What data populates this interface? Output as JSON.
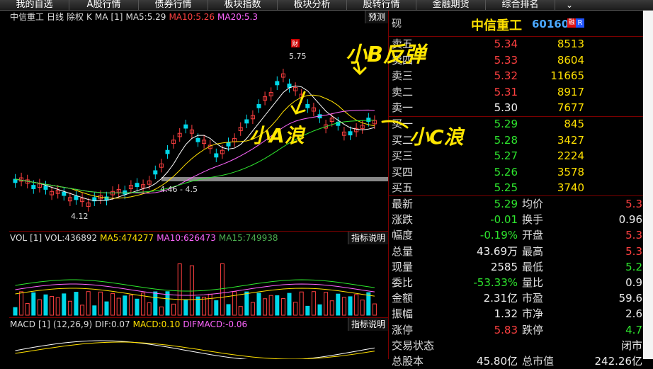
{
  "tabs": [
    "我的自选",
    "A股行情",
    "债券行情",
    "板块指数",
    "板块分析",
    "股转行情",
    "金融期货",
    "综合排名"
  ],
  "tab_more_icon": "double-chevron-down-icon",
  "kline": {
    "stock": "中信重工",
    "period": "日线",
    "adjust": "除权",
    "chart": "K",
    "indicator": "MA",
    "param": "[1]",
    "ma5": "MA5:5.29",
    "ma10": "MA10:5.26",
    "ma20": "MA20:5.3",
    "forecast_btn": "预测",
    "high_label": "5.75",
    "low_label": "4.12",
    "mid_label": "4.46 - 4.5",
    "cai_badge": "财",
    "colors": {
      "up": "#ff4040",
      "down": "#00d7e8",
      "ma5": "#ffffff",
      "ma10": "#ffe000",
      "ma20": "#ff66ff",
      "ma60": "#2ee62e"
    }
  },
  "vol": {
    "name": "VOL",
    "param": "[1]",
    "vol": "VOL:436892",
    "ma5": "MA5:474277",
    "ma10": "MA10:626473",
    "ma15": "MA15:749938",
    "help": "指标说明"
  },
  "macd": {
    "name": "MACD",
    "param": "[1]",
    "args": "(12,26,9)",
    "dif": "DIF:0.07",
    "macd": "MACD:0.10",
    "difmacd": "DIFMACD:-0.06",
    "help": "指标说明"
  },
  "quote": {
    "mark": "砚",
    "name": "中信重工",
    "code": "601608",
    "badge": "融",
    "badge2": "R",
    "asks": [
      {
        "label": "卖五",
        "price": "5.34",
        "vol": "8513"
      },
      {
        "label": "卖四",
        "price": "5.33",
        "vol": "8604"
      },
      {
        "label": "卖三",
        "price": "5.32",
        "vol": "11665"
      },
      {
        "label": "卖二",
        "price": "5.31",
        "vol": "8917"
      },
      {
        "label": "卖一",
        "price": "5.30",
        "vol": "7677"
      }
    ],
    "bids": [
      {
        "label": "买一",
        "price": "5.29",
        "vol": "845"
      },
      {
        "label": "买二",
        "price": "5.28",
        "vol": "3427"
      },
      {
        "label": "买三",
        "price": "5.27",
        "vol": "2224"
      },
      {
        "label": "买四",
        "price": "5.26",
        "vol": "3578"
      },
      {
        "label": "买五",
        "price": "5.25",
        "vol": "3740"
      }
    ],
    "stats": [
      {
        "l1": "最新",
        "v1": "5.29",
        "c1": "green",
        "l2": "均价",
        "v2": "5.3",
        "c2": "red"
      },
      {
        "l1": "涨跌",
        "v1": "-0.01",
        "c1": "green",
        "l2": "换手",
        "v2": "0.96",
        "c2": "white"
      },
      {
        "l1": "幅度",
        "v1": "-0.19%",
        "c1": "green",
        "l2": "开盘",
        "v2": "5.3",
        "c2": "red"
      },
      {
        "l1": "总量",
        "v1": "43.69万",
        "c1": "white",
        "l2": "最高",
        "v2": "5.3",
        "c2": "red"
      },
      {
        "l1": "现量",
        "v1": "2585",
        "c1": "white",
        "l2": "最低",
        "v2": "5.2",
        "c2": "green"
      },
      {
        "l1": "委比",
        "v1": "-53.33%",
        "c1": "green",
        "l2": "量比",
        "v2": "0.9",
        "c2": "white"
      },
      {
        "l1": "金额",
        "v1": "2.31亿",
        "c1": "white",
        "l2": "市盈",
        "v2": "59.6",
        "c2": "white"
      },
      {
        "l1": "振幅",
        "v1": "1.32",
        "c1": "white",
        "l2": "市净",
        "v2": "2.6",
        "c2": "white"
      },
      {
        "l1": "涨停",
        "v1": "5.83",
        "c1": "red",
        "l2": "跌停",
        "v2": "4.7",
        "c2": "green"
      },
      {
        "l1": "交易状态",
        "v1": "",
        "c1": "white",
        "l2": "",
        "v2": "闭市",
        "c2": "white"
      },
      {
        "l1": "总股本",
        "v1": "45.80亿",
        "c1": "white",
        "l2": "总市值",
        "v2": "242.26亿",
        "c2": "white"
      }
    ]
  },
  "annotations": {
    "rebound": "小B反弹",
    "wave_a": "小A浪",
    "wave_c": "小C浪"
  }
}
